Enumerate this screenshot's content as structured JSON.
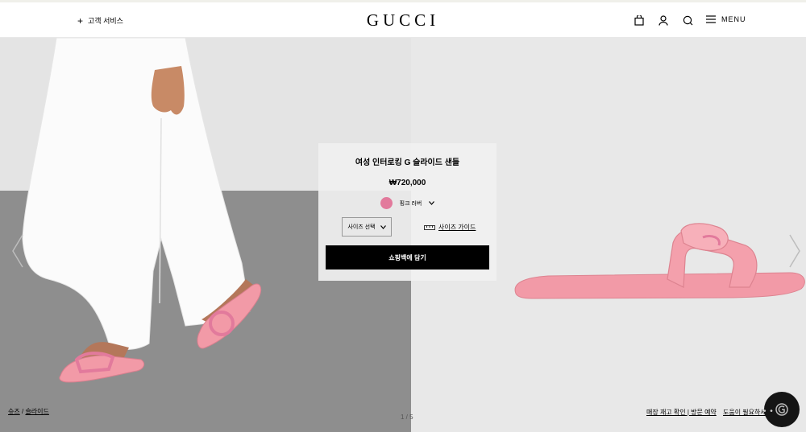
{
  "header": {
    "customer_service": "고객 서비스",
    "logo": "GUCCI",
    "menu_label": "MENU",
    "icons": [
      "shopping-bag-icon",
      "user-icon",
      "search-icon",
      "hamburger-icon"
    ]
  },
  "product": {
    "name": "여성 인터로킹 G 슬라이드 샌들",
    "price": "₩720,000",
    "color_name": "핑크 러버",
    "color_hex": "#e27a9c",
    "size_select": "사이즈 선택",
    "size_guide": "사이즈 가이드",
    "add_to_bag": "쇼핑백에 담기"
  },
  "breadcrumb": {
    "level1": "슈즈",
    "separator": "/",
    "level2": "슬라이드"
  },
  "pager": "1 / 5",
  "footer": {
    "store_stock": "매장 재고 확인 | 방문 예약",
    "help": "도움이 필요하세요?"
  },
  "colors": {
    "accent": "#000000",
    "product_pink": "#f29aa7",
    "panel_bg": "#f0f0f0"
  }
}
